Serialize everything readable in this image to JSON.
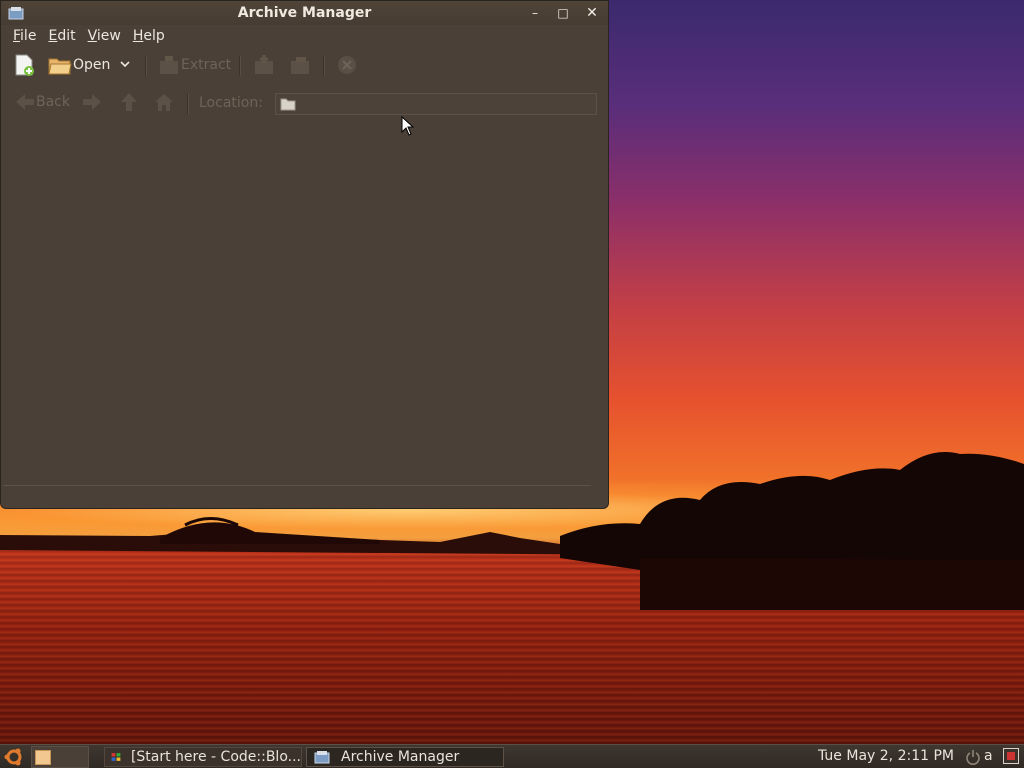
{
  "window": {
    "title": "Archive Manager",
    "minimize_glyph": "–",
    "maximize_glyph": "□",
    "close_glyph": "✕"
  },
  "menubar": {
    "items": [
      {
        "label": "File",
        "mnemonic": "F",
        "rest": "ile"
      },
      {
        "label": "Edit",
        "mnemonic": "E",
        "rest": "dit"
      },
      {
        "label": "View",
        "mnemonic": "V",
        "rest": "iew"
      },
      {
        "label": "Help",
        "mnemonic": "H",
        "rest": "elp"
      }
    ]
  },
  "toolbar": {
    "open_label": "Open",
    "extract_label": "Extract"
  },
  "locationbar": {
    "back_label": "Back",
    "location_label": "Location:",
    "location_value": ""
  },
  "taskbar": {
    "tasks": [
      {
        "label": "[Start here - Code::Blo..."
      },
      {
        "label": "Archive Manager"
      }
    ],
    "clock": "Tue May  2,  2:11 PM",
    "user": "a"
  },
  "colors": {
    "window_bg": "#4a4038",
    "text": "#ece7df",
    "disabled_text": "#6e6357"
  }
}
